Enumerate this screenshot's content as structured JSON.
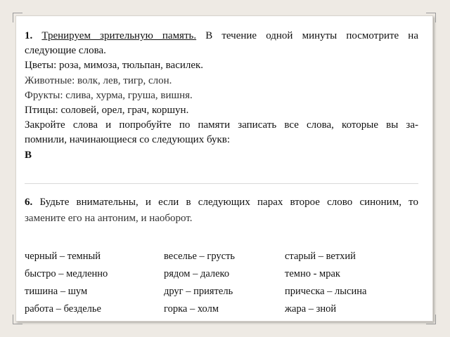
{
  "task1": {
    "num": "1.",
    "underlined": "Тренируем зрительную память.",
    "rest_line1": " В течение одной минуты посмотрите на",
    "line2": "следующие слова.",
    "categories": [
      {
        "label": "Цветы",
        "words": ": роза, мимоза, тюльпан, василек."
      },
      {
        "label": "Животные",
        "words": ": волк, лев, тигр, слон."
      },
      {
        "label": "Фрукты",
        "words": ": слива, хурма, груша, вишня."
      },
      {
        "label": "Птицы",
        "words": ": соловей, орел, грач, коршун."
      }
    ],
    "instruction_line1": "Закройте слова и попробуйте по памяти записать все слова, которые вы за-",
    "instruction_line2": "помнили, начинающиеся со следующих букв:",
    "letter": "В"
  },
  "task6": {
    "num": "6.",
    "line1_rest": " Будьте внимательны, и если в следующих парах второе слово синоним, то",
    "line2": "замените его на антоним, и наоборот.",
    "pairs": [
      [
        "черный – темный",
        "веселье – грусть",
        "старый – ветхий"
      ],
      [
        "быстро – медленно",
        "рядом – далеко",
        "темно - мрак"
      ],
      [
        "тишина – шум",
        "друг – приятель",
        "прическа – лысина"
      ],
      [
        "работа – безделье",
        "горка – холм",
        "жара – зной"
      ]
    ]
  }
}
